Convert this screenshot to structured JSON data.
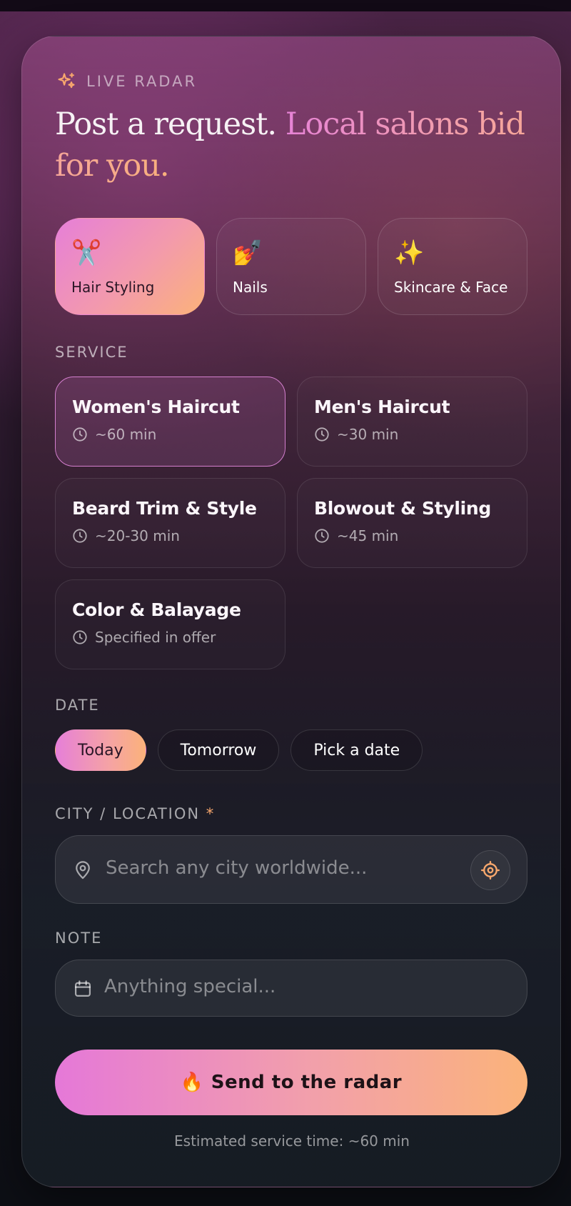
{
  "eyebrow": "LIVE RADAR",
  "headline": {
    "part1": "Post a request.",
    "part2": "Local salons bid for you."
  },
  "categories": [
    {
      "emoji": "✂️",
      "label": "Hair Styling",
      "active": true
    },
    {
      "emoji": "💅",
      "label": "Nails",
      "active": false
    },
    {
      "emoji": "✨",
      "label": "Skincare & Face",
      "active": false
    }
  ],
  "service_label": "SERVICE",
  "services": [
    {
      "name": "Women's Haircut",
      "duration": "~60 min",
      "active": true
    },
    {
      "name": "Men's Haircut",
      "duration": "~30 min",
      "active": false
    },
    {
      "name": "Beard Trim & Style",
      "duration": "~20-30 min",
      "active": false
    },
    {
      "name": "Blowout & Styling",
      "duration": "~45 min",
      "active": false
    },
    {
      "name": "Color & Balayage",
      "duration": "Specified in offer",
      "active": false
    }
  ],
  "date_label": "DATE",
  "dates": [
    {
      "label": "Today",
      "active": true
    },
    {
      "label": "Tomorrow",
      "active": false
    },
    {
      "label": "Pick a date",
      "active": false
    }
  ],
  "city": {
    "label": "CITY / LOCATION",
    "required_mark": "*",
    "placeholder": "Search any city worldwide..."
  },
  "note": {
    "label": "NOTE",
    "placeholder": "Anything special..."
  },
  "send_button": {
    "emoji": "🔥",
    "label": "Send to the radar"
  },
  "footnote": "Estimated service time: ~60 min",
  "colors": {
    "accent_pink": "#e67fd8",
    "accent_orange": "#fbb27a",
    "location_icon": "#f9a86d"
  },
  "icons": {
    "eyebrow": "sparkles-icon",
    "duration": "clock-icon",
    "city": "map-pin-icon",
    "locate": "crosshair-icon",
    "note": "calendar-icon"
  }
}
